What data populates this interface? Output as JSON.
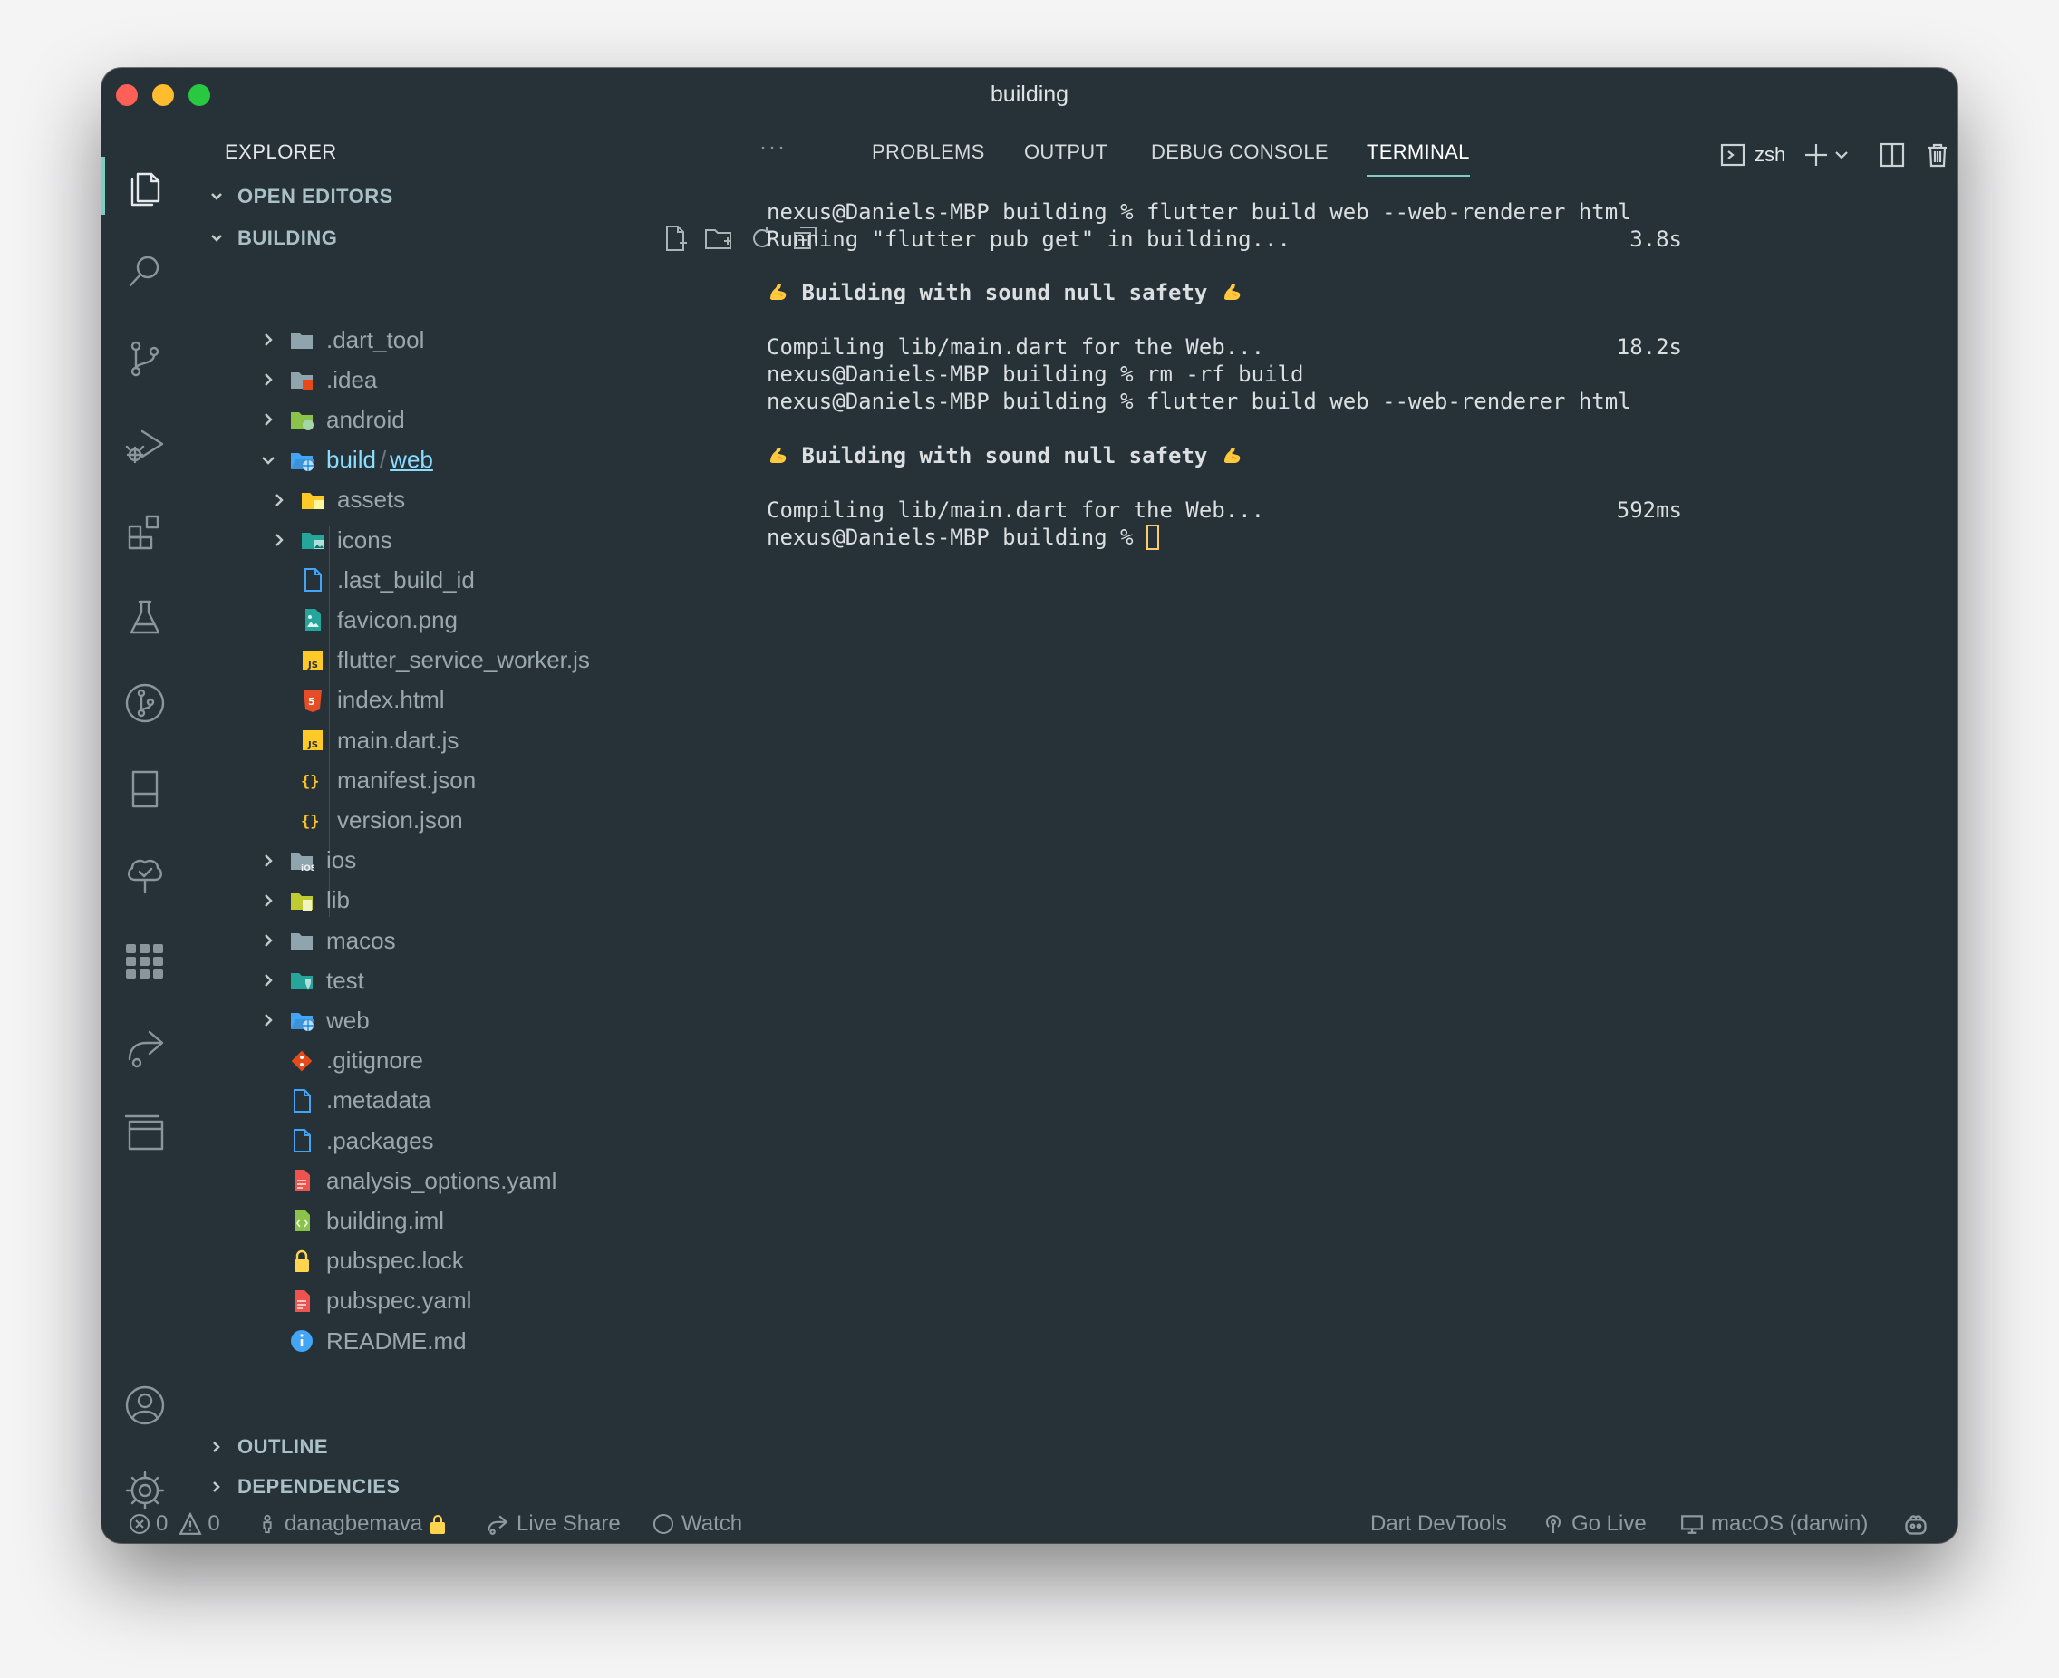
{
  "window": {
    "title": "building"
  },
  "activity_bar": {
    "items": [
      "files-icon",
      "search-icon",
      "source-control-icon",
      "run-debug-icon",
      "extensions-icon",
      "testing-icon",
      "git-graph-icon",
      "remote-explorer-icon",
      "tree-check-icon",
      "grid-apps-icon",
      "live-share-icon",
      "panel-window-icon"
    ],
    "bottom": [
      "account-icon",
      "settings-gear-icon"
    ]
  },
  "explorer": {
    "title": "EXPLORER",
    "more": "···",
    "open_editors": "OPEN EDITORS",
    "workspace": "BUILDING",
    "outline": "OUTLINE",
    "dependencies": "DEPENDENCIES",
    "tree": [
      {
        "name": ".dart_tool",
        "type": "folder",
        "icon": "folder-icon",
        "color": "#90a4ae"
      },
      {
        "name": ".idea",
        "type": "folder",
        "icon": "intellij-folder-icon",
        "color": "#90a4ae"
      },
      {
        "name": "android",
        "type": "folder",
        "icon": "android-folder-icon",
        "color": "#8bc34a"
      },
      {
        "name": "build",
        "sep": "/",
        "name2": "web",
        "type": "folder-open",
        "icon": "web-folder-icon",
        "color": "#42a5f5"
      },
      {
        "name": "assets",
        "type": "folder",
        "icon": "assets-folder-icon",
        "color": "#ffca28"
      },
      {
        "name": "icons",
        "type": "folder",
        "icon": "images-folder-icon",
        "color": "#26a69a"
      },
      {
        "name": ".last_build_id",
        "type": "file",
        "icon": "document-icon",
        "color": "#42a5f5"
      },
      {
        "name": "favicon.png",
        "type": "file",
        "icon": "image-file-icon",
        "color": "#26a69a"
      },
      {
        "name": "flutter_service_worker.js",
        "type": "file",
        "icon": "javascript-icon",
        "color": "#ffca28"
      },
      {
        "name": "index.html",
        "type": "file",
        "icon": "html5-icon",
        "color": "#e44d26"
      },
      {
        "name": "main.dart.js",
        "type": "file",
        "icon": "javascript-icon",
        "color": "#ffca28"
      },
      {
        "name": "manifest.json",
        "type": "file",
        "icon": "json-icon",
        "color": "#fbc02d"
      },
      {
        "name": "version.json",
        "type": "file",
        "icon": "json-icon",
        "color": "#fbc02d"
      },
      {
        "name": "ios",
        "type": "folder",
        "icon": "ios-folder-icon",
        "color": "#90a4ae"
      },
      {
        "name": "lib",
        "type": "folder",
        "icon": "lib-folder-icon",
        "color": "#c0ca33"
      },
      {
        "name": "macos",
        "type": "folder",
        "icon": "folder-icon",
        "color": "#90a4ae"
      },
      {
        "name": "test",
        "type": "folder",
        "icon": "test-folder-icon",
        "color": "#26a69a"
      },
      {
        "name": "web",
        "type": "folder",
        "icon": "web-folder-icon",
        "color": "#42a5f5"
      },
      {
        "name": ".gitignore",
        "type": "file",
        "icon": "git-icon",
        "color": "#e64a19"
      },
      {
        "name": ".metadata",
        "type": "file",
        "icon": "document-icon",
        "color": "#42a5f5"
      },
      {
        "name": ".packages",
        "type": "file",
        "icon": "document-icon",
        "color": "#42a5f5"
      },
      {
        "name": "analysis_options.yaml",
        "type": "file",
        "icon": "yaml-icon",
        "color": "#ef5350"
      },
      {
        "name": "building.iml",
        "type": "file",
        "icon": "xml-file-icon",
        "color": "#8bc34a"
      },
      {
        "name": "pubspec.lock",
        "type": "file",
        "icon": "lock-icon",
        "color": "#ffd54f"
      },
      {
        "name": "pubspec.yaml",
        "type": "file",
        "icon": "yaml-icon",
        "color": "#ef5350"
      },
      {
        "name": "README.md",
        "type": "file",
        "icon": "info-icon",
        "color": "#42a5f5"
      }
    ]
  },
  "panel": {
    "tabs": [
      "PROBLEMS",
      "OUTPUT",
      "DEBUG CONSOLE",
      "TERMINAL"
    ],
    "active_tab": "TERMINAL",
    "shell": "zsh"
  },
  "terminal": {
    "lines": [
      {
        "text": "nexus@Daniels-MBP building % flutter build web --web-renderer html"
      },
      {
        "text": "Running \"flutter pub get\" in building...",
        "time": "3.8s"
      },
      {
        "text": " Building with sound null safety ",
        "bold": true,
        "emoji": true
      },
      {
        "text": "Compiling lib/main.dart for the Web...",
        "time": "18.2s"
      },
      {
        "text": "nexus@Daniels-MBP building % rm -rf build"
      },
      {
        "text": "nexus@Daniels-MBP building % flutter build web --web-renderer html"
      },
      {
        "text": " Building with sound null safety ",
        "bold": true,
        "emoji": true
      },
      {
        "text": "Compiling lib/main.dart for the Web...",
        "time": "592ms"
      },
      {
        "text": "nexus@Daniels-MBP building % ",
        "cursor": true
      }
    ]
  },
  "status": {
    "errors": "0",
    "warnings": "0",
    "account": "danagbemava",
    "live_share": "Live Share",
    "watch": "Watch",
    "devtools": "Dart DevTools",
    "go_live": "Go Live",
    "device": "macOS (darwin)"
  },
  "colors": {
    "background": "#263238",
    "accent": "#80cbc4",
    "text": "#9aa7ac",
    "highlight": "#89ddff"
  }
}
